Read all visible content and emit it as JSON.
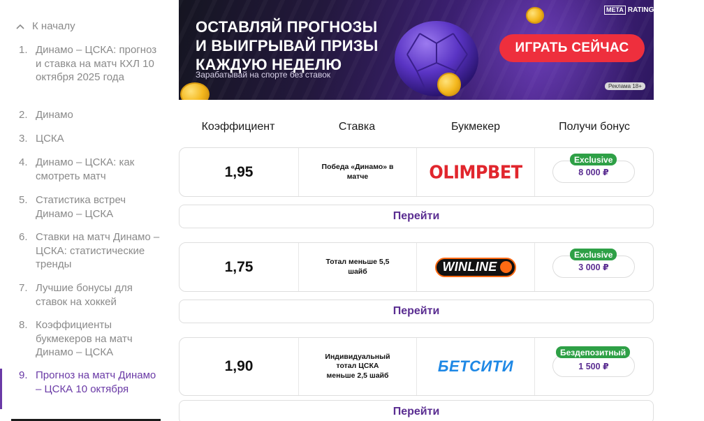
{
  "toc": {
    "back_label": "К началу",
    "items": [
      {
        "num": "1.",
        "label": "Динамо – ЦСКА: прогноз и ставка на матч КХЛ 10 октября 2025 года"
      },
      {
        "num": "2.",
        "label": "Динамо"
      },
      {
        "num": "3.",
        "label": "ЦСКА"
      },
      {
        "num": "4.",
        "label": "Динамо – ЦСКА: как смотреть матч"
      },
      {
        "num": "5.",
        "label": "Статистика встреч Динамо – ЦСКА"
      },
      {
        "num": "6.",
        "label": "Ставки на матч Динамо – ЦСКА: статистические тренды"
      },
      {
        "num": "7.",
        "label": "Лучшие бонусы для ставок на хоккей"
      },
      {
        "num": "8.",
        "label": "Коэффициенты букмекеров на матч Динамо – ЦСКА"
      },
      {
        "num": "9.",
        "label": "Прогноз на матч Динамо – ЦСКА 10 октября"
      }
    ],
    "active_index": 8
  },
  "banner": {
    "title_lines": [
      "ОСТАВЛЯЙ ПРОГНОЗЫ",
      "И ВЫИГРЫВАЙ ПРИЗЫ",
      "КАЖДУЮ НЕДЕЛЮ"
    ],
    "subtitle": "Зарабатывай на спорте без ставок",
    "cta": "ИГРАТЬ СЕЙЧАС",
    "brand_box": "META",
    "brand_text": "RATINGS",
    "ad_label": "Реклама 18+"
  },
  "table": {
    "headers": [
      "Коэффициент",
      "Ставка",
      "Букмекер",
      "Получи бонус"
    ],
    "goto_label": "Перейти",
    "rows": [
      {
        "odds": "1,95",
        "bet_lines": [
          "Победа «Динамо» в",
          "матче"
        ],
        "bookmaker": "OLIMPBET",
        "logo": "olimpbet-logo",
        "badge": "Exclusive",
        "bonus": "8 000 ₽"
      },
      {
        "odds": "1,75",
        "bet_lines": [
          "Тотал меньше 5,5",
          "шайб"
        ],
        "bookmaker": "WINLINE",
        "logo": "winline-logo",
        "badge": "Exclusive",
        "bonus": "3 000 ₽"
      },
      {
        "odds": "1,90",
        "bet_lines": [
          "Индивидуальный",
          "тотал ЦСКА",
          "меньше 2,5 шайб"
        ],
        "bookmaker": "БЕТСИТИ",
        "logo": "betcity-logo",
        "badge": "Бездепозитный",
        "bonus": "1 500 ₽"
      }
    ]
  },
  "colors": {
    "accent": "#5a2d91",
    "badge_green": "#2ea046",
    "cta_red": "#ee2f3d",
    "olimpbet_red": "#e1262d",
    "winline_orange": "#ff6a13",
    "betcity_blue": "#1e88e5"
  }
}
